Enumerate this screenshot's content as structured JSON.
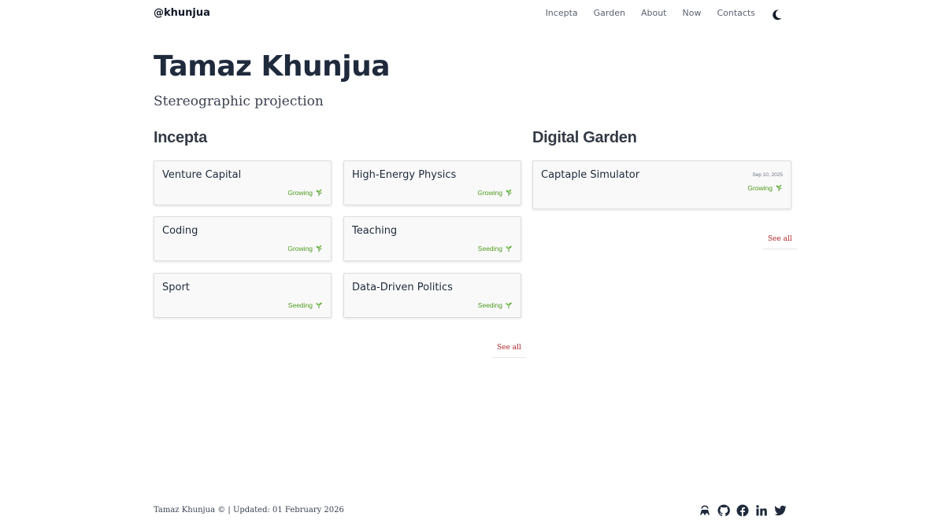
{
  "header": {
    "brand": "@khunjua",
    "nav": [
      "Incepta",
      "Garden",
      "About",
      "Now",
      "Contacts"
    ]
  },
  "hero": {
    "title": "Tamaz Khunjua",
    "subtitle": "Stereographic projection"
  },
  "incepta": {
    "title": "Incepta",
    "cards": [
      {
        "title": "Venture Capital",
        "status": "Growing"
      },
      {
        "title": "High-Energy Physics",
        "status": "Growing"
      },
      {
        "title": "Coding",
        "status": "Growing"
      },
      {
        "title": "Teaching",
        "status": "Seeding"
      },
      {
        "title": "Sport",
        "status": "Seeding"
      },
      {
        "title": "Data-Driven Politics",
        "status": "Seeding"
      }
    ],
    "see_all": "See all"
  },
  "garden": {
    "title": "Digital Garden",
    "cards": [
      {
        "title": "Captaple Simulator",
        "date": "Sep 10, 2025",
        "status": "Growing"
      }
    ],
    "see_all": "See all"
  },
  "footer": {
    "text": "Tamaz Khunjua © | Updated: 01 February 2026"
  },
  "icons": {
    "theme": "moon-icon",
    "growing": "herb-icon",
    "seeding": "seedling-icon",
    "social": [
      "anaconda-icon",
      "github-icon",
      "facebook-icon",
      "linkedin-icon",
      "twitter-icon"
    ]
  },
  "colors": {
    "status_green": "#4f9a1e",
    "see_all_red": "#b0262b",
    "title_navy": "#1f2a3c"
  }
}
